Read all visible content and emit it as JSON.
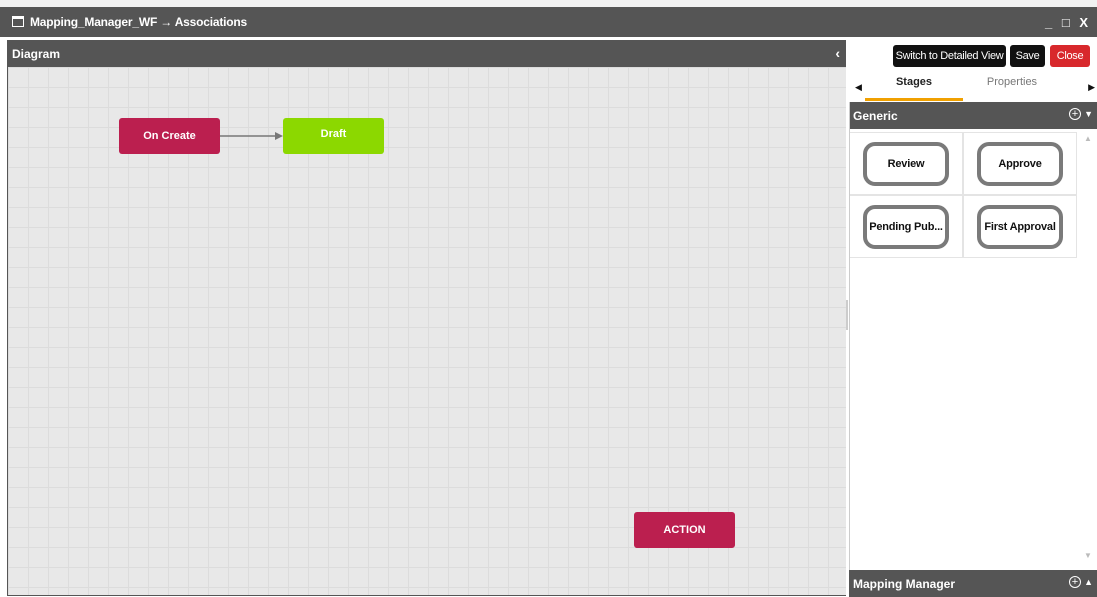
{
  "window": {
    "title": "Mapping_Manager_WF → Associations",
    "controls": "_ □ X"
  },
  "diagram": {
    "header_label": "Diagram",
    "collapse_glyph": "‹",
    "nodes": {
      "on_create": "On Create",
      "draft": "Draft",
      "action": "ACTION"
    },
    "colors": {
      "on_create": "#bb1f4f",
      "draft": "#8cd800",
      "action": "#bb1f4f"
    }
  },
  "toolbar": {
    "switch_label": "Switch to Detailed View",
    "save_label": "Save",
    "close_label": "Close"
  },
  "tabs": {
    "left_arrow": "◀",
    "right_arrow": "▶",
    "stages": "Stages",
    "properties": "Properties"
  },
  "groups": {
    "generic": {
      "label": "Generic",
      "plus": "+",
      "caret": "▼",
      "stages": [
        "Review",
        "Approve",
        "Pending Pub...",
        "First Approval"
      ]
    },
    "mapping_manager": {
      "label": "Mapping Manager",
      "plus": "+",
      "caret": "▲"
    }
  },
  "scrollbar": {
    "up": "▲",
    "down": "▼"
  }
}
